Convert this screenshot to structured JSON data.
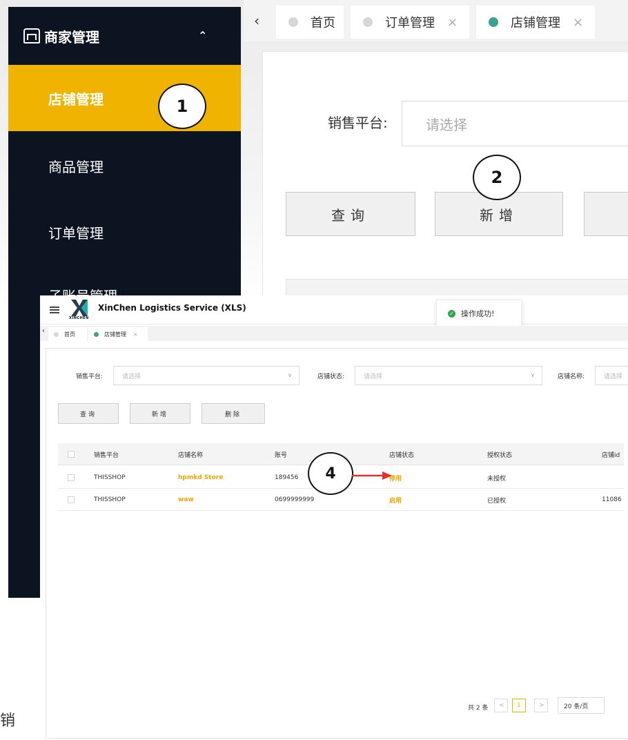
{
  "back": {
    "sidebar": {
      "header": "商家管理",
      "items": [
        {
          "label": "店铺管理"
        },
        {
          "label": "商品管理"
        },
        {
          "label": "订单管理"
        },
        {
          "label": "子账号管理"
        }
      ]
    },
    "tabs": [
      {
        "label": "首页"
      },
      {
        "label": "订单管理",
        "close": "×"
      },
      {
        "label": "店铺管理",
        "close": "×"
      }
    ],
    "filter": {
      "label": "销售平台:",
      "placeholder": "请选择"
    },
    "buttons": {
      "query": "查询",
      "add": "新增"
    },
    "cut_char": "销"
  },
  "front": {
    "app_title": "XinChen Logistics Service (XLS)",
    "logo_text": "XINCHEN",
    "toast": "操作成功!",
    "tabs": [
      {
        "label": "首页"
      },
      {
        "label": "店铺管理",
        "close": "×"
      }
    ],
    "filters": [
      {
        "label": "销售平台:",
        "placeholder": "请选择"
      },
      {
        "label": "店铺状态:",
        "placeholder": "请选择"
      },
      {
        "label": "店铺名称:",
        "placeholder": "请选择"
      }
    ],
    "buttons": {
      "query": "查询",
      "add": "新增",
      "delete": "删除"
    },
    "table": {
      "columns": [
        "销售平台",
        "店铺名称",
        "账号",
        "店铺状态",
        "授权状态",
        "店铺id"
      ],
      "rows": [
        {
          "platform": "THISSHOP",
          "name": "hpmkd Store",
          "account": "189456",
          "status": "停用",
          "auth": "未授权",
          "id": ""
        },
        {
          "platform": "THISSHOP",
          "name": "waw",
          "account": "0699999999",
          "status": "启用",
          "auth": "已授权",
          "id": "11086"
        }
      ]
    },
    "pagination": {
      "total": "共 2 条",
      "prev": "<",
      "page": "1",
      "next": ">",
      "page_size": "20 条/页"
    }
  },
  "callouts": [
    "1",
    "2",
    "4"
  ],
  "colors": {
    "accent": "#f0b400",
    "sidebar_bg": "#0c1421",
    "status_green": "#3aa38e",
    "arrow": "#e52e2e"
  }
}
